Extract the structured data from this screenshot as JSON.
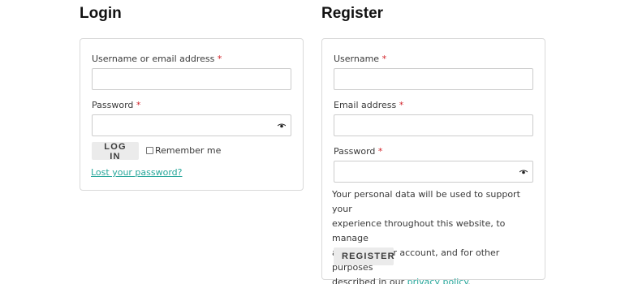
{
  "login": {
    "title": "Login",
    "username_label": "Username or email address",
    "required_mark": "*",
    "password_label": "Password",
    "submit_label": "LOG IN",
    "remember_label": "Remember me",
    "lost_password_link": "Lost your password?"
  },
  "register": {
    "title": "Register",
    "username_label": "Username",
    "email_label": "Email address",
    "password_label": "Password",
    "required_mark": "*",
    "privacy_line1": "Your personal data will be used to support your",
    "privacy_line2": "experience throughout this website, to manage",
    "privacy_line3": "access to your account, and for other purposes",
    "privacy_line4_prefix": "described in our ",
    "privacy_link": "privacy policy",
    "privacy_line4_suffix": ".",
    "submit_label": "REGISTER"
  },
  "colors": {
    "accent_link": "#26a69a",
    "required": "#d2232a",
    "button_bg": "#ebebeb",
    "border": "#d9d9d9"
  },
  "icons": {
    "password_toggle": "eye-icon"
  }
}
